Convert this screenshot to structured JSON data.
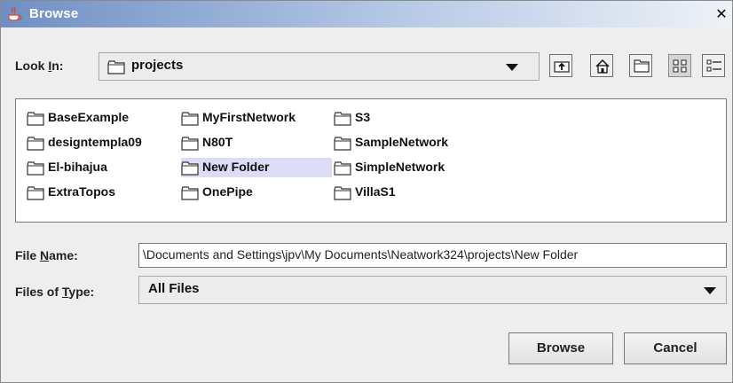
{
  "window": {
    "title": "Browse",
    "close_glyph": "✕"
  },
  "look_in": {
    "label_prefix": "Look ",
    "label_mnemonic": "I",
    "label_suffix": "n:",
    "value": "projects"
  },
  "toolbar": {
    "buttons": [
      {
        "name": "up-one-level",
        "icon": "folder-up-icon"
      },
      {
        "name": "home",
        "icon": "home-icon"
      },
      {
        "name": "new-folder",
        "icon": "new-folder-icon"
      },
      {
        "name": "list-view",
        "icon": "list-view-icon",
        "selected": true
      },
      {
        "name": "details-view",
        "icon": "details-view-icon"
      }
    ]
  },
  "files": [
    {
      "name": "BaseExample"
    },
    {
      "name": "designtempla09"
    },
    {
      "name": "El-bihajua"
    },
    {
      "name": "ExtraTopos"
    },
    {
      "name": "MyFirstNetwork"
    },
    {
      "name": "N80T"
    },
    {
      "name": "New Folder",
      "selected": true
    },
    {
      "name": "OnePipe"
    },
    {
      "name": "S3"
    },
    {
      "name": "SampleNetwork"
    },
    {
      "name": "SimpleNetwork"
    },
    {
      "name": "VillaS1"
    }
  ],
  "file_name": {
    "label_prefix": "File ",
    "label_mnemonic": "N",
    "label_suffix": "ame:",
    "value": "\\Documents and Settings\\jpv\\My Documents\\Neatwork324\\projects\\New Folder"
  },
  "files_of_type": {
    "label_prefix": "Files of ",
    "label_mnemonic": "T",
    "label_suffix": "ype:",
    "value": "All Files"
  },
  "buttons": {
    "browse": "Browse",
    "cancel": "Cancel"
  }
}
